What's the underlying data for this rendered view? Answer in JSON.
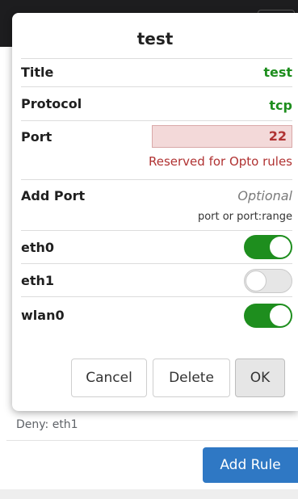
{
  "background": {
    "deny_text": "Deny: eth1",
    "add_rule_label": "Add Rule"
  },
  "modal": {
    "title": "test",
    "fields": {
      "title_label": "Title",
      "title_value": "test",
      "protocol_label": "Protocol",
      "protocol_value": "tcp",
      "port_label": "Port",
      "port_value": "22",
      "port_error": "Reserved for Opto rules",
      "add_port_label": "Add Port",
      "add_port_placeholder": "Optional",
      "add_port_hint": "port or port:range"
    },
    "interfaces": [
      {
        "name": "eth0",
        "enabled": true
      },
      {
        "name": "eth1",
        "enabled": false
      },
      {
        "name": "wlan0",
        "enabled": true
      }
    ],
    "buttons": {
      "cancel": "Cancel",
      "delete": "Delete",
      "ok": "OK"
    }
  },
  "colors": {
    "green": "#1e8e1e",
    "error_red": "#b03232",
    "primary_blue": "#2f78c4"
  }
}
